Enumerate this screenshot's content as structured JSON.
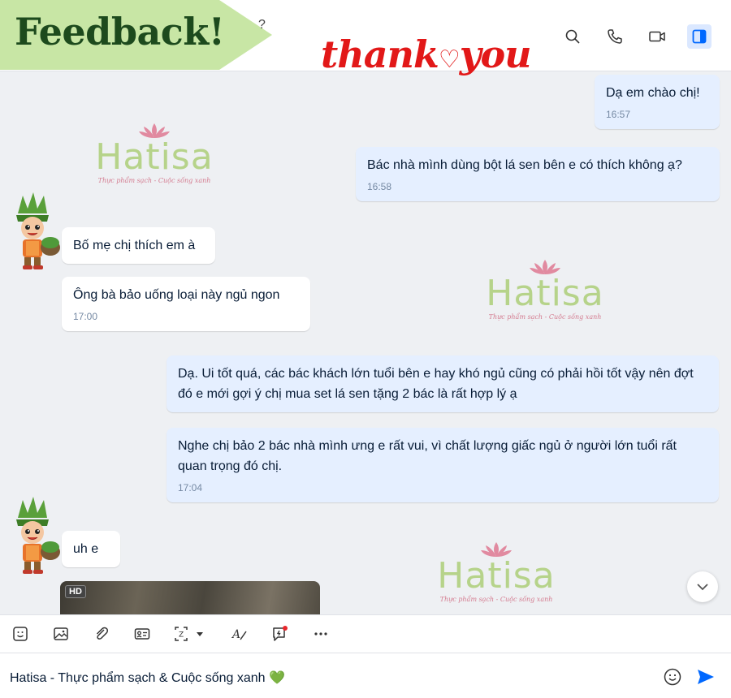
{
  "header": {
    "banner_text": "Feedback!",
    "hint_text": "?",
    "overlay_text_a": "thank",
    "overlay_heart": "♡",
    "overlay_text_b": "you",
    "actions": [
      "search-icon",
      "phone-icon",
      "video-icon",
      "sidebar-toggle-icon"
    ]
  },
  "watermark": {
    "brand": "Hatisa",
    "tagline": "Thực phẩm sạch - Cuộc sống xanh"
  },
  "messages": [
    {
      "sender": "me",
      "text": "Dạ em chào chị!",
      "time": "16:57"
    },
    {
      "sender": "me",
      "text": "Bác nhà mình dùng bột lá sen bên e có thích không ạ?",
      "time": "16:58"
    },
    {
      "sender": "them",
      "text": "Bố mẹ chị thích em à",
      "time": ""
    },
    {
      "sender": "them",
      "text": "Ông bà bảo uống loại này ngủ ngon",
      "time": "17:00"
    },
    {
      "sender": "me",
      "text": "Dạ. Ui tốt quá, các bác khách lớn tuổi bên e hay khó ngủ cũng có phải hồi tốt vậy nên đợt đó e mới gợi ý chị mua set lá sen tặng 2 bác là rất hợp lý ạ",
      "time": ""
    },
    {
      "sender": "me",
      "text": "Nghe chị bảo 2 bác nhà mình ưng e rất vui, vì chất lượng giấc ngủ ở người lớn tuổi rất quan trọng đó chị.",
      "time": "17:04"
    },
    {
      "sender": "them",
      "text": "uh e",
      "time": ""
    }
  ],
  "photo": {
    "badge": "HD"
  },
  "toolbar": {
    "icons": [
      "sticker-icon",
      "image-icon",
      "attachment-icon",
      "contact-card-icon",
      "screenshot-icon",
      "dropdown-caret-icon",
      "format-text-icon",
      "quick-message-icon",
      "more-icon"
    ]
  },
  "composer": {
    "draft": "Hatisa - Thực phẩm sạch & Cuộc sống xanh 💚"
  },
  "colors": {
    "my_bubble": "#e5efff",
    "their_bubble": "#ffffff",
    "accent": "#0068ff",
    "banner_green": "#c8e6a5",
    "thankyou_red": "#e21818"
  }
}
